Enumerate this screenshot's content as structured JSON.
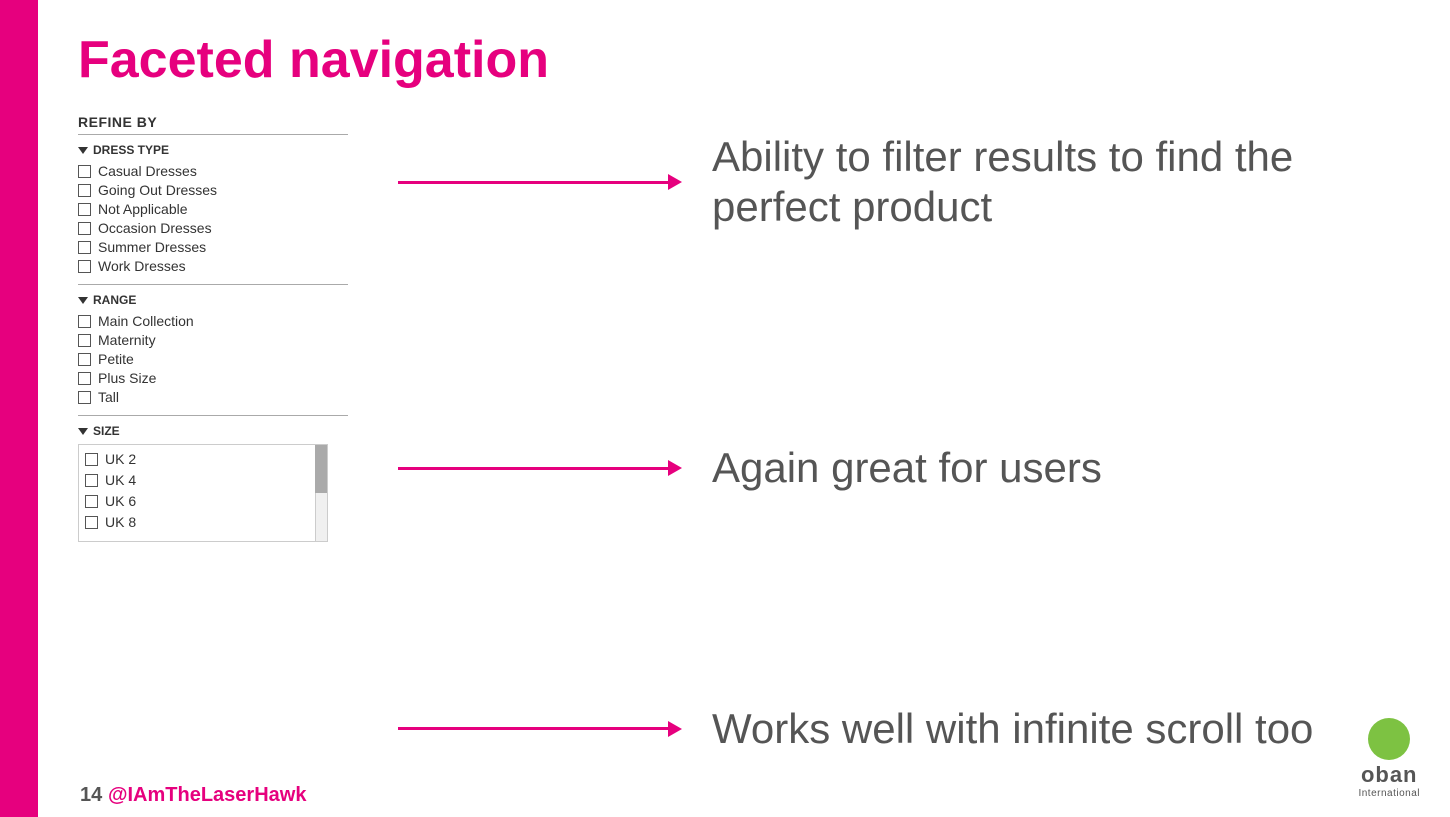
{
  "slide": {
    "title": "Faceted navigation",
    "slide_number": "14",
    "twitter": "@IAmTheLaserHawk"
  },
  "filter_panel": {
    "refine_label": "REFINE BY",
    "sections": [
      {
        "id": "dress-type",
        "header": "DRESS TYPE",
        "items": [
          "Casual Dresses",
          "Going Out Dresses",
          "Not Applicable",
          "Occasion Dresses",
          "Summer Dresses",
          "Work Dresses"
        ]
      },
      {
        "id": "range",
        "header": "RANGE",
        "items": [
          "Main Collection",
          "Maternity",
          "Petite",
          "Plus Size",
          "Tall"
        ]
      },
      {
        "id": "size",
        "header": "SIZE",
        "items": [
          "UK 2",
          "UK 4",
          "UK 6",
          "UK 8"
        ]
      }
    ]
  },
  "annotations": [
    {
      "id": "annotation-1",
      "text": "Ability to filter results to find the perfect product"
    },
    {
      "id": "annotation-2",
      "text": "Again great for users"
    },
    {
      "id": "annotation-3",
      "text": "Works well with infinite scroll too"
    }
  ],
  "logo": {
    "text": "oban",
    "subtext": "International"
  }
}
